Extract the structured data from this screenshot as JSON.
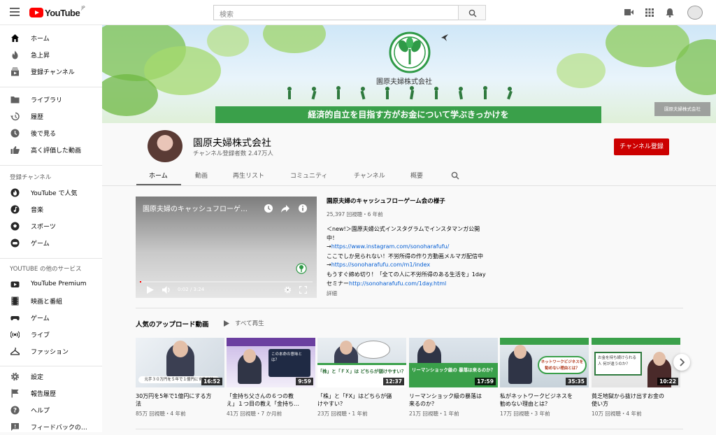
{
  "header": {
    "logo_word": "YouTube",
    "logo_region": "JP",
    "search_placeholder": "検索"
  },
  "sidebar": {
    "main": [
      {
        "label": "ホーム",
        "icon": "home-icon"
      },
      {
        "label": "急上昇",
        "icon": "flame-icon"
      },
      {
        "label": "登録チャンネル",
        "icon": "subscriptions-icon"
      }
    ],
    "library": [
      {
        "label": "ライブラリ",
        "icon": "library-icon"
      },
      {
        "label": "履歴",
        "icon": "history-icon"
      },
      {
        "label": "後で見る",
        "icon": "clock-icon"
      },
      {
        "label": "高く評価した動画",
        "icon": "thumbs-up-icon"
      }
    ],
    "subs_heading": "登録チャンネル",
    "subs": [
      {
        "label": "YouTube で人気",
        "icon": "popular-icon"
      },
      {
        "label": "音楽",
        "icon": "music-icon"
      },
      {
        "label": "スポーツ",
        "icon": "sports-icon"
      },
      {
        "label": "ゲーム",
        "icon": "gaming-icon"
      }
    ],
    "more_heading": "YOUTUBE の他のサービス",
    "more": [
      {
        "label": "YouTube Premium",
        "icon": "youtube-icon"
      },
      {
        "label": "映画と番組",
        "icon": "film-icon"
      },
      {
        "label": "ゲーム",
        "icon": "gamepad-icon"
      },
      {
        "label": "ライブ",
        "icon": "live-icon"
      },
      {
        "label": "ファッション",
        "icon": "hanger-icon"
      }
    ],
    "bottom": [
      {
        "label": "設定",
        "icon": "gear-icon"
      },
      {
        "label": "報告履歴",
        "icon": "flag-icon"
      },
      {
        "label": "ヘルプ",
        "icon": "help-icon"
      },
      {
        "label": "フィードバックの…",
        "icon": "feedback-icon"
      }
    ]
  },
  "banner": {
    "company": "園原夫婦株式会社",
    "tagline": "経済的自立を目指す方がお金について学ぶきっかけを",
    "side_badge": "園原夫婦株式会社"
  },
  "channel": {
    "name": "園原夫婦株式会社",
    "subscribers": "チャンネル登録者数 2.47万人",
    "subscribe_label": "チャンネル登録",
    "tabs": [
      "ホーム",
      "動画",
      "再生リスト",
      "コミュニティ",
      "チャンネル",
      "概要"
    ]
  },
  "featured": {
    "player_title": "園原夫婦のキャッシュフローゲ…",
    "time": "0:02 / 3:24",
    "progress": 0.01,
    "title": "園原夫婦のキャッシュフローゲーム会の様子",
    "meta": "25,397 回視聴・6 年前",
    "desc_1": "＜new!＞園原夫婦公式インスタグラムでインスタマンガ公開",
    "desc_2": "中！",
    "desc_3_prefix": "→",
    "desc_3_link": "https://www.instagram.com/sonoharafufu/",
    "desc_4": "ここでしか見られない！不労所得の作り方動画メルマガ配信中",
    "desc_5_prefix": "→",
    "desc_5_link": "https://sonoharafufu.com/m1/index",
    "desc_6": "もうすぐ締め切り！「全ての人に不労所得のある生活を」1day",
    "desc_7_prefix": "セミナー",
    "desc_7_link": "http://sonoharafufu.com/1day.html",
    "more_label": "詳細"
  },
  "shelf": {
    "title": "人気のアップロード動画",
    "play_all": "すべて再生",
    "videos": [
      {
        "title_1": "30万円を5年で1億円にする方",
        "title_2": "法",
        "meta": "85万 回視聴・4 年前",
        "duration": "16:52",
        "caption": "元手３０万円を５年で１億円にする方法"
      },
      {
        "title_1": "「金持ち父さんの６つの教",
        "title_2": "え」１つ目の教え「金持ち…",
        "meta": "41万 回視聴・7 か月前",
        "duration": "9:59",
        "caption": "この本命の意味とは？"
      },
      {
        "title_1": "「株」と「FX」はどちらが儲",
        "title_2": "けやすい？",
        "meta": "23万 回視聴・1 年前",
        "duration": "12:37",
        "caption": "「株」と「ＦＸ」は どちらが儲けやすい？"
      },
      {
        "title_1": "リーマンショック級の暴落は",
        "title_2": "来るのか？",
        "meta": "21万 回視聴・1 年前",
        "duration": "17:59",
        "caption": "リーマンショック級の 暴落は来るのか？"
      },
      {
        "title_1": "私がネットワークビジネスを",
        "title_2": "勧めない理由とは？",
        "meta": "17万 回視聴・3 年前",
        "duration": "35:35",
        "caption": "ネットワークビジネスを 勧めない理由とは？"
      },
      {
        "title_1": "貧乏地獄から抜け出すお金の",
        "title_2": "使い方",
        "meta": "10万 回視聴・4 年前",
        "duration": "10:22",
        "caption": "お金を持ち続けられる人 何が違うのか？"
      }
    ]
  }
}
